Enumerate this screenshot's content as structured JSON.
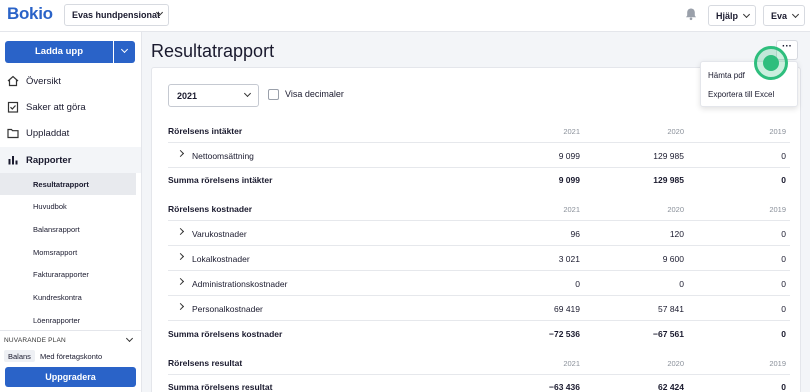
{
  "topbar": {
    "logo": "Bokio",
    "company": "Evas hundpensionat",
    "help_label": "Hjälp",
    "user_label": "Eva"
  },
  "sidebar": {
    "upload_label": "Ladda upp",
    "items": [
      {
        "label": "Översikt",
        "icon": "home-icon"
      },
      {
        "label": "Saker att göra",
        "icon": "checklist-icon"
      },
      {
        "label": "Uppladdat",
        "icon": "folder-icon"
      },
      {
        "label": "Rapporter",
        "icon": "bar-chart-icon"
      }
    ],
    "sub_items": [
      "Resultatrapport",
      "Huvudbok",
      "Balansrapport",
      "Momsrapport",
      "Fakturarapporter",
      "Kundreskontra",
      "Löenrapporter"
    ],
    "plan": {
      "heading": "NUVARANDE PLAN",
      "badge": "Balans",
      "name": "Med företagskonto",
      "upgrade_label": "Uppgradera"
    }
  },
  "main": {
    "title": "Resultatrapport",
    "more_label": "···",
    "year_select": "2021",
    "decimals_label": "Visa decimaler"
  },
  "menu": {
    "items": [
      "Hämta pdf",
      "Exportera till Excel"
    ]
  },
  "report": {
    "income_head": {
      "label": "Rörelsens intäkter",
      "y1": "2021",
      "y2": "2020",
      "y3": "2019"
    },
    "income_rows": [
      {
        "label": "Nettoomsättning",
        "v1": "9 099",
        "v2": "129 985",
        "v3": "0"
      }
    ],
    "income_sum": {
      "label": "Summa rörelsens intäkter",
      "v1": "9 099",
      "v2": "129 985",
      "v3": "0"
    },
    "cost_head": {
      "label": "Rörelsens kostnader",
      "y1": "2021",
      "y2": "2020",
      "y3": "2019"
    },
    "cost_rows": [
      {
        "label": "Varukostnader",
        "v1": "96",
        "v2": "120",
        "v3": "0"
      },
      {
        "label": "Lokalkostnader",
        "v1": "3 021",
        "v2": "9 600",
        "v3": "0"
      },
      {
        "label": "Administrationskostnader",
        "v1": "0",
        "v2": "0",
        "v3": "0"
      },
      {
        "label": "Personalkostnader",
        "v1": "69 419",
        "v2": "57 841",
        "v3": "0"
      }
    ],
    "cost_sum": {
      "label": "Summa rörelsens kostnader",
      "v1": "−72 536",
      "v2": "−67 561",
      "v3": "0"
    },
    "result_head": {
      "label": "Rörelsens resultat",
      "y1": "2021",
      "y2": "2020",
      "y3": "2019"
    },
    "result_sum": {
      "label": "Summa rörelsens resultat",
      "v1": "−63 436",
      "v2": "62 424",
      "v3": "0"
    }
  },
  "colors": {
    "brand": "#2a63c8",
    "indicator": "#2ebe7d"
  }
}
